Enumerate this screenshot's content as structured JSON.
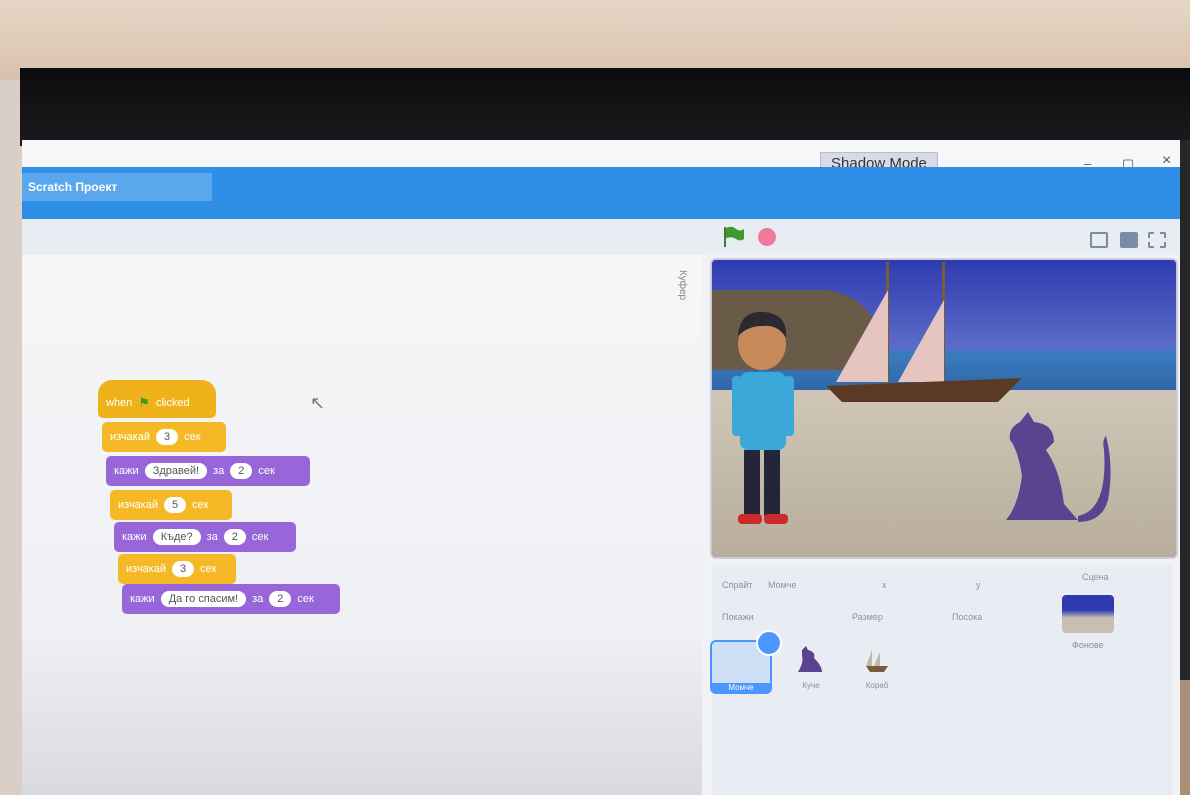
{
  "window": {
    "mode_label": "Shadow Mode",
    "minimize": "–",
    "maximize": "▢",
    "close": "×"
  },
  "menubar": {
    "project_title": "Scratch Проект"
  },
  "code_area": {
    "side_label": "Куфер"
  },
  "scripts": [
    {
      "type": "event",
      "text_before": "when",
      "text_after": "clicked"
    },
    {
      "type": "control",
      "text_before": "изчакай",
      "value": "3",
      "text_after": "сек"
    },
    {
      "type": "looks",
      "text_before": "кажи",
      "value": "Здравей!",
      "mid": "за",
      "value2": "2",
      "text_after": "сек"
    },
    {
      "type": "control",
      "text_before": "изчакай",
      "value": "5",
      "text_after": "сек"
    },
    {
      "type": "looks",
      "text_before": "кажи",
      "value": "Къде?",
      "mid": "за",
      "value2": "2",
      "text_after": "сек"
    },
    {
      "type": "control",
      "text_before": "изчакай",
      "value": "3",
      "text_after": "сек"
    },
    {
      "type": "looks",
      "text_before": "кажи",
      "value": "Да го спасим!",
      "mid": "за",
      "value2": "2",
      "text_after": "сек"
    }
  ],
  "sprite_info": {
    "sprite_label": "Спрайт",
    "sprite_name": "Момче",
    "show_label": "Покажи",
    "size_label": "Размер",
    "direction_label": "Посока",
    "x_label": "x",
    "y_label": "y",
    "stage_label": "Сцена",
    "backdrops_label": "Фонове"
  },
  "sprites": [
    {
      "name": "Момче",
      "selected": true
    },
    {
      "name": "Куче",
      "selected": false
    },
    {
      "name": "Кораб",
      "selected": false
    }
  ],
  "colors": {
    "menubar": "#2f8ee6",
    "event_block": "#f0b21a",
    "looks_block": "#9966d9",
    "flag": "#3c9b2c",
    "stop": "#f07a9a"
  }
}
